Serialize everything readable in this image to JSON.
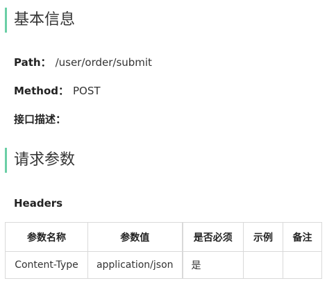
{
  "sections": {
    "basic_info": {
      "title": "基本信息",
      "path_label": "Path：",
      "path_value": "/user/order/submit",
      "method_label": "Method：",
      "method_value": "POST",
      "desc_label": "接口描述："
    },
    "request_params": {
      "title": "请求参数",
      "headers_label": "Headers"
    }
  },
  "headers_table": {
    "columns": [
      "参数名称",
      "参数值",
      "是否必须",
      "示例",
      "备注"
    ],
    "rows": [
      [
        "Content-Type",
        "application/json",
        "是",
        "",
        ""
      ]
    ]
  },
  "colors": {
    "accent": "#6bcfa6",
    "border": "#d9d9d9",
    "text": "#333333"
  }
}
